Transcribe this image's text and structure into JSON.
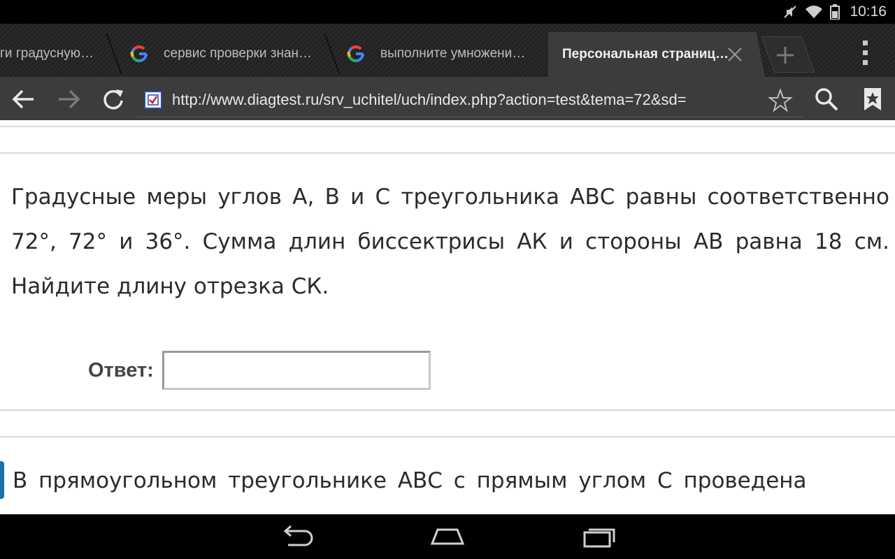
{
  "status_bar": {
    "time": "10:16",
    "icons": [
      "mute-icon",
      "wifi-icon",
      "battery-icon"
    ]
  },
  "tabs": [
    {
      "title": "ги градусную…",
      "active": false
    },
    {
      "title": "сервис проверки знан…",
      "active": false,
      "icon": "google-icon"
    },
    {
      "title": "выполните умножени…",
      "active": false,
      "icon": "google-icon"
    },
    {
      "title": "Персональная страниц…",
      "active": true
    }
  ],
  "toolbar": {
    "url": "http://www.diagtest.ru/srv_uchitel/uch/index.php?action=test&tema=72&sd="
  },
  "page": {
    "question_text": "Градусные меры углов А, В и С треугольника АВС равны соответственно 72°, 72° и 36°. Сумма длин биссектрисы АК и стороны АВ равна 18 см. Найдите длину отрезка СК.",
    "answer_label": "Ответ:",
    "answer_value": "",
    "next_question_text": "В прямоугольном треугольнике АВС с прямым углом С проведена"
  },
  "colors": {
    "accent": "#1e6fa8",
    "toolbar_bg": "#3c3c3c"
  }
}
